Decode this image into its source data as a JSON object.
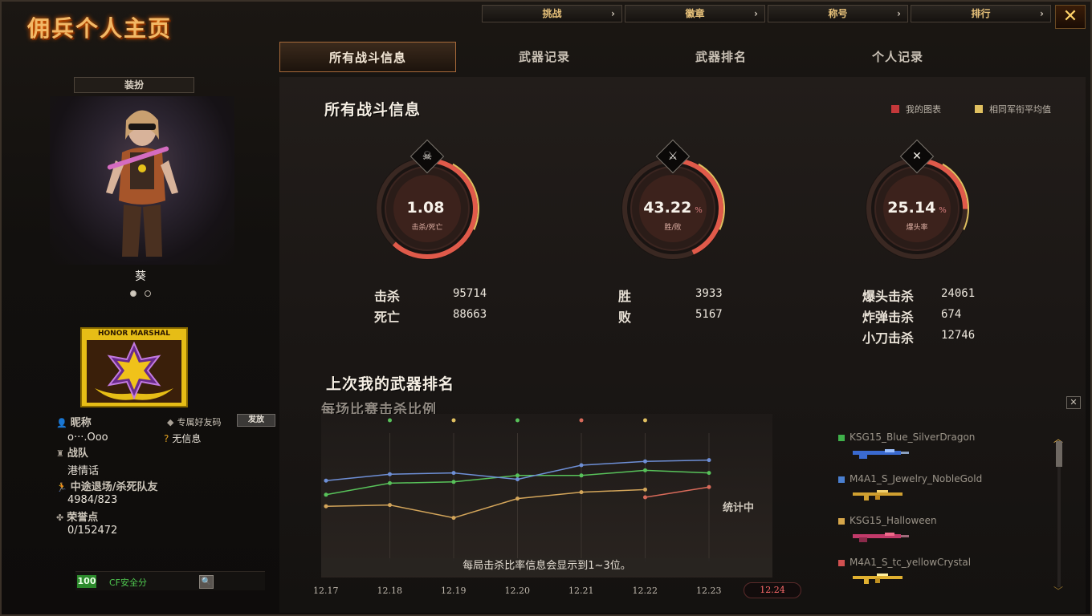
{
  "page": {
    "title": "佣兵个人主页",
    "close_icon": "close-x-icon",
    "accent": "#e8a85a"
  },
  "top_nav": [
    {
      "label": "挑战",
      "icon": "chevron-right-icon"
    },
    {
      "label": "徽章",
      "icon": "chevron-right-icon"
    },
    {
      "label": "称号",
      "icon": "chevron-right-icon"
    },
    {
      "label": "排行",
      "icon": "chevron-right-icon"
    }
  ],
  "tabs": [
    {
      "label": "所有战斗信息",
      "active": true
    },
    {
      "label": "武器记录",
      "active": false
    },
    {
      "label": "武器排名",
      "active": false
    },
    {
      "label": "个人记录",
      "active": false
    }
  ],
  "profile": {
    "outfit_label": "装扮",
    "character_name": "葵",
    "carousel_pages": 2,
    "carousel_current": 1,
    "badge_text": "HONOR MARSHAL",
    "nickname_label": "昵称",
    "nickname_value": "o···.Ooo",
    "friend_code_label": "专属好友码",
    "send_button": "发放",
    "no_info": "无信息",
    "clan_label": "战队",
    "clan_value": "港情话",
    "quit_label": "中途退场/杀死队友",
    "quit_value": "4984/823",
    "honor_label": "荣誉点",
    "honor_value": "0/152472",
    "security_score": "100",
    "security_label": "CF安全分"
  },
  "battle_info": {
    "title": "所有战斗信息",
    "legend": [
      {
        "label": "我的图表",
        "color": "#c4383a"
      },
      {
        "label": "相同军衔平均值",
        "color": "#e0c060"
      }
    ],
    "gauges": [
      {
        "value": "1.08",
        "unit": "",
        "label": "击杀/死亡",
        "icon": "skull-icon",
        "fill": 0.62
      },
      {
        "value": "43.22",
        "unit": "%",
        "label": "胜/败",
        "icon": "crossed-swords-icon",
        "fill": 0.4322
      },
      {
        "value": "25.14",
        "unit": "%",
        "label": "爆头率",
        "icon": "headshot-rifle-icon",
        "fill": 0.2514
      }
    ],
    "stats": {
      "kills_label": "击杀",
      "kills": "95714",
      "deaths_label": "死亡",
      "deaths": "88663",
      "wins_label": "胜",
      "wins": "3933",
      "losses_label": "败",
      "losses": "5167",
      "headshot_label": "爆头击杀",
      "headshot": "24061",
      "grenade_label": "炸弹击杀",
      "grenade": "674",
      "knife_label": "小刀击杀",
      "knife": "12746"
    }
  },
  "weapon_rank": {
    "title": "上次我的武器排名",
    "subtitle": "每场比赛击杀比例",
    "calc_status": "统计中",
    "caption": "每局击杀比率信息会显示到1~3位。",
    "weapons": [
      {
        "name": "KSG15_Blue_SilverDragon",
        "color": "#3fb04a",
        "gun_color": "#3a6ad0"
      },
      {
        "name": "M4A1_S_Jewelry_NobleGold",
        "color": "#4a7fd0",
        "gun_color": "#d0a030"
      },
      {
        "name": "KSG15_Halloween",
        "color": "#d6a64a",
        "gun_color": "#c23a6a"
      },
      {
        "name": "M4A1_S_tc_yellowCrystal",
        "color": "#d05050",
        "gun_color": "#e0b030"
      }
    ]
  },
  "chart_data": {
    "type": "line",
    "title": "每场比赛击杀比例",
    "x": [
      "12.17",
      "12.18",
      "12.19",
      "12.20",
      "12.21",
      "12.22",
      "12.23",
      "12.24"
    ],
    "active_x": "12.24",
    "ylim": [
      0,
      1
    ],
    "series": [
      {
        "name": "KSG15_Blue_SilverDragon",
        "color": "#58c25a",
        "values": [
          0.52,
          0.61,
          0.62,
          0.67,
          0.67,
          0.71,
          0.69,
          null
        ]
      },
      {
        "name": "M4A1_S_Jewelry_NobleGold",
        "color": "#6e8fd6",
        "values": [
          0.63,
          0.68,
          0.69,
          0.64,
          0.75,
          0.78,
          0.79,
          null
        ]
      },
      {
        "name": "KSG15_Halloween",
        "color": "#d3a55a",
        "values": [
          0.43,
          0.44,
          0.34,
          0.49,
          0.54,
          0.56,
          null,
          null
        ]
      },
      {
        "name": "M4A1_S_tc_yellowCrystal",
        "color": "#d86a5a",
        "values": [
          null,
          null,
          null,
          null,
          null,
          0.5,
          0.58,
          null
        ]
      }
    ],
    "marker_colors": [
      "#58c25a",
      "#e0c060",
      "#58c25a",
      "#d86a5a",
      "#e0c060"
    ]
  }
}
